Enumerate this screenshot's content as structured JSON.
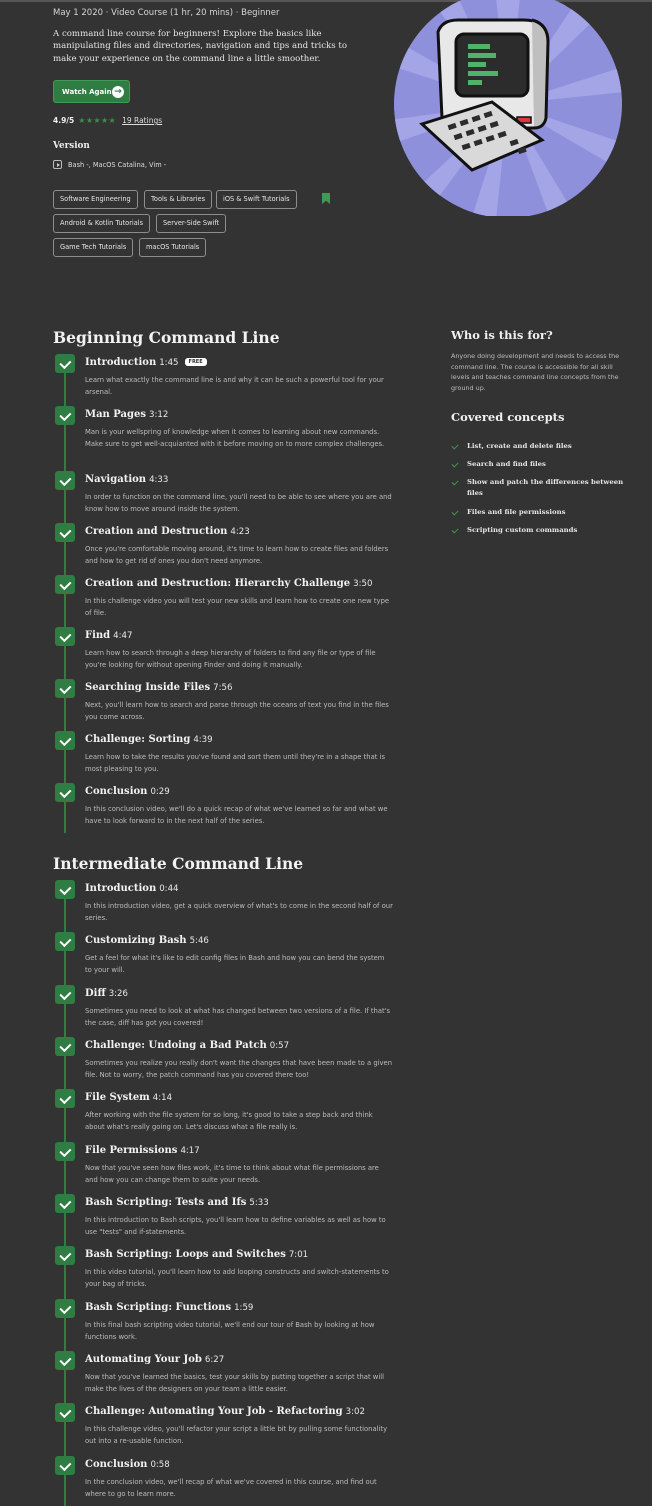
{
  "course": {
    "meta": "May 1 2020 · Video Course (1 hr, 20 mins) · Beginner",
    "description": "A command line course for beginners! Explore the basics like manipulating files and directories, navigation and tips and tricks to make your experience on the command line a little smoother.",
    "watch_label": "Watch Again",
    "rating_score": "4.9/5",
    "rating_stars": "★★★★★",
    "rating_count": "19 Ratings",
    "version_title": "Version",
    "version_value": "Bash -, MacOS Catalina, Vim -",
    "tags": [
      "Software Engineering",
      "Tools & Libraries",
      "iOS & Swift Tutorials",
      "Android & Kotlin Tutorials",
      "Server-Side Swift",
      "Game Tech Tutorials",
      "macOS Tutorials"
    ]
  },
  "colors": {
    "accent": "#2f7d43",
    "background": "#333333",
    "hero_circle": "#8f90dc"
  },
  "sections": [
    {
      "title": "Beginning Command Line",
      "lessons": [
        {
          "title": "Introduction",
          "time": "1:45",
          "badge": "FREE",
          "desc": "Learn what exactly the command line is and why it can be such a powerful tool for your arsenal."
        },
        {
          "title": "Man Pages",
          "time": "3:12",
          "desc": "Man is your wellspring of knowledge when it comes to learning about new commands. Make sure to get well-acquianted with it before moving on to more complex challenges."
        },
        {
          "title": "Navigation",
          "time": "4:33",
          "desc": "In order to function on the command line, you'll need to be able to see where you are and know how to move around inside the system."
        },
        {
          "title": "Creation and Destruction",
          "time": "4:23",
          "desc": "Once you're comfortable moving around, it's time to learn how to create files and folders and how to get rid of ones you don't need anymore."
        },
        {
          "title": "Creation and Destruction: Hierarchy Challenge",
          "time": "3:50",
          "desc": "In this challenge video you will test your new skills and learn how to create one new type of file."
        },
        {
          "title": "Find",
          "time": "4:47",
          "desc": "Learn how to search through a deep hierarchy of folders to find any file or type of file you're looking for without opening Finder and doing it manually."
        },
        {
          "title": "Searching Inside Files",
          "time": "7:56",
          "desc": "Next, you'll learn how to search and parse through the oceans of text you find in the files you come across."
        },
        {
          "title": "Challenge: Sorting",
          "time": "4:39",
          "desc": "Learn how to take the results you've found and sort them until they're in a shape that is most pleasing to you."
        },
        {
          "title": "Conclusion",
          "time": "0:29",
          "desc": "In this conclusion video, we'll do a quick recap of what we've learned so far and what we have to look forward to in the next half of the series."
        }
      ]
    },
    {
      "title": "Intermediate Command Line",
      "lessons": [
        {
          "title": "Introduction",
          "time": "0:44",
          "desc": "In this introduction video, get a quick overview of what's to come in the second half of our series."
        },
        {
          "title": "Customizing Bash",
          "time": "5:46",
          "desc": "Get a feel for what it's like to edit config files in Bash and how you can bend the system to your will."
        },
        {
          "title": "Diff",
          "time": "3:26",
          "desc": "Sometimes you need to look at what has changed between two versions of a file. If that's the case, diff has got you covered!"
        },
        {
          "title": "Challenge: Undoing a Bad Patch",
          "time": "0:57",
          "desc": "Sometimes you realize you really don't want the changes that have been made to a given file. Not to worry, the patch command has you covered there too!"
        },
        {
          "title": "File System",
          "time": "4:14",
          "desc": "After working with the file system for so long, it's good to take a step back and think about what's really going on. Let's discuss what a file really is."
        },
        {
          "title": "File Permissions",
          "time": "4:17",
          "desc": "Now that you've seen how files work, it's time to think about what file permissions are and how you can change them to suite your needs."
        },
        {
          "title": "Bash Scripting: Tests and Ifs",
          "time": "5:33",
          "desc": "In this introduction to Bash scripts, you'll learn how to define variables as well as how to use \"tests\" and if-statements."
        },
        {
          "title": "Bash Scripting: Loops and Switches",
          "time": "7:01",
          "desc": "In this video tutorial, you'll learn how to add looping constructs and switch-statements to your bag of tricks."
        },
        {
          "title": "Bash Scripting: Functions",
          "time": "1:59",
          "desc": "In this final bash scripting video tutorial, we'll end our tour of Bash by looking at how functions work."
        },
        {
          "title": "Automating Your Job",
          "time": "6:27",
          "desc": "Now that you've learned the basics, test your skills by putting together a script that will make the lives of the designers on your team a little easier."
        },
        {
          "title": "Challenge: Automating Your Job - Refactoring",
          "time": "3:02",
          "desc": "In this challenge video, you'll refactor your script a little bit by pulling some functionality out into a re-usable function."
        },
        {
          "title": "Conclusion",
          "time": "0:58",
          "desc": "In the conclusion video, we'll recap of what we've covered in this course, and find out where to go to learn more."
        }
      ]
    }
  ],
  "sidebar": {
    "who_title": "Who is this for?",
    "who_desc": "Anyone doing development and needs to access the command line. The course is accessible for all skill levels and teaches command line concepts from the ground up.",
    "concepts_title": "Covered concepts",
    "concepts": [
      "List, create and delete files",
      "Search and find files",
      "Show and patch the differences between files",
      "Files and file permissions",
      "Scripting custom commands"
    ]
  }
}
